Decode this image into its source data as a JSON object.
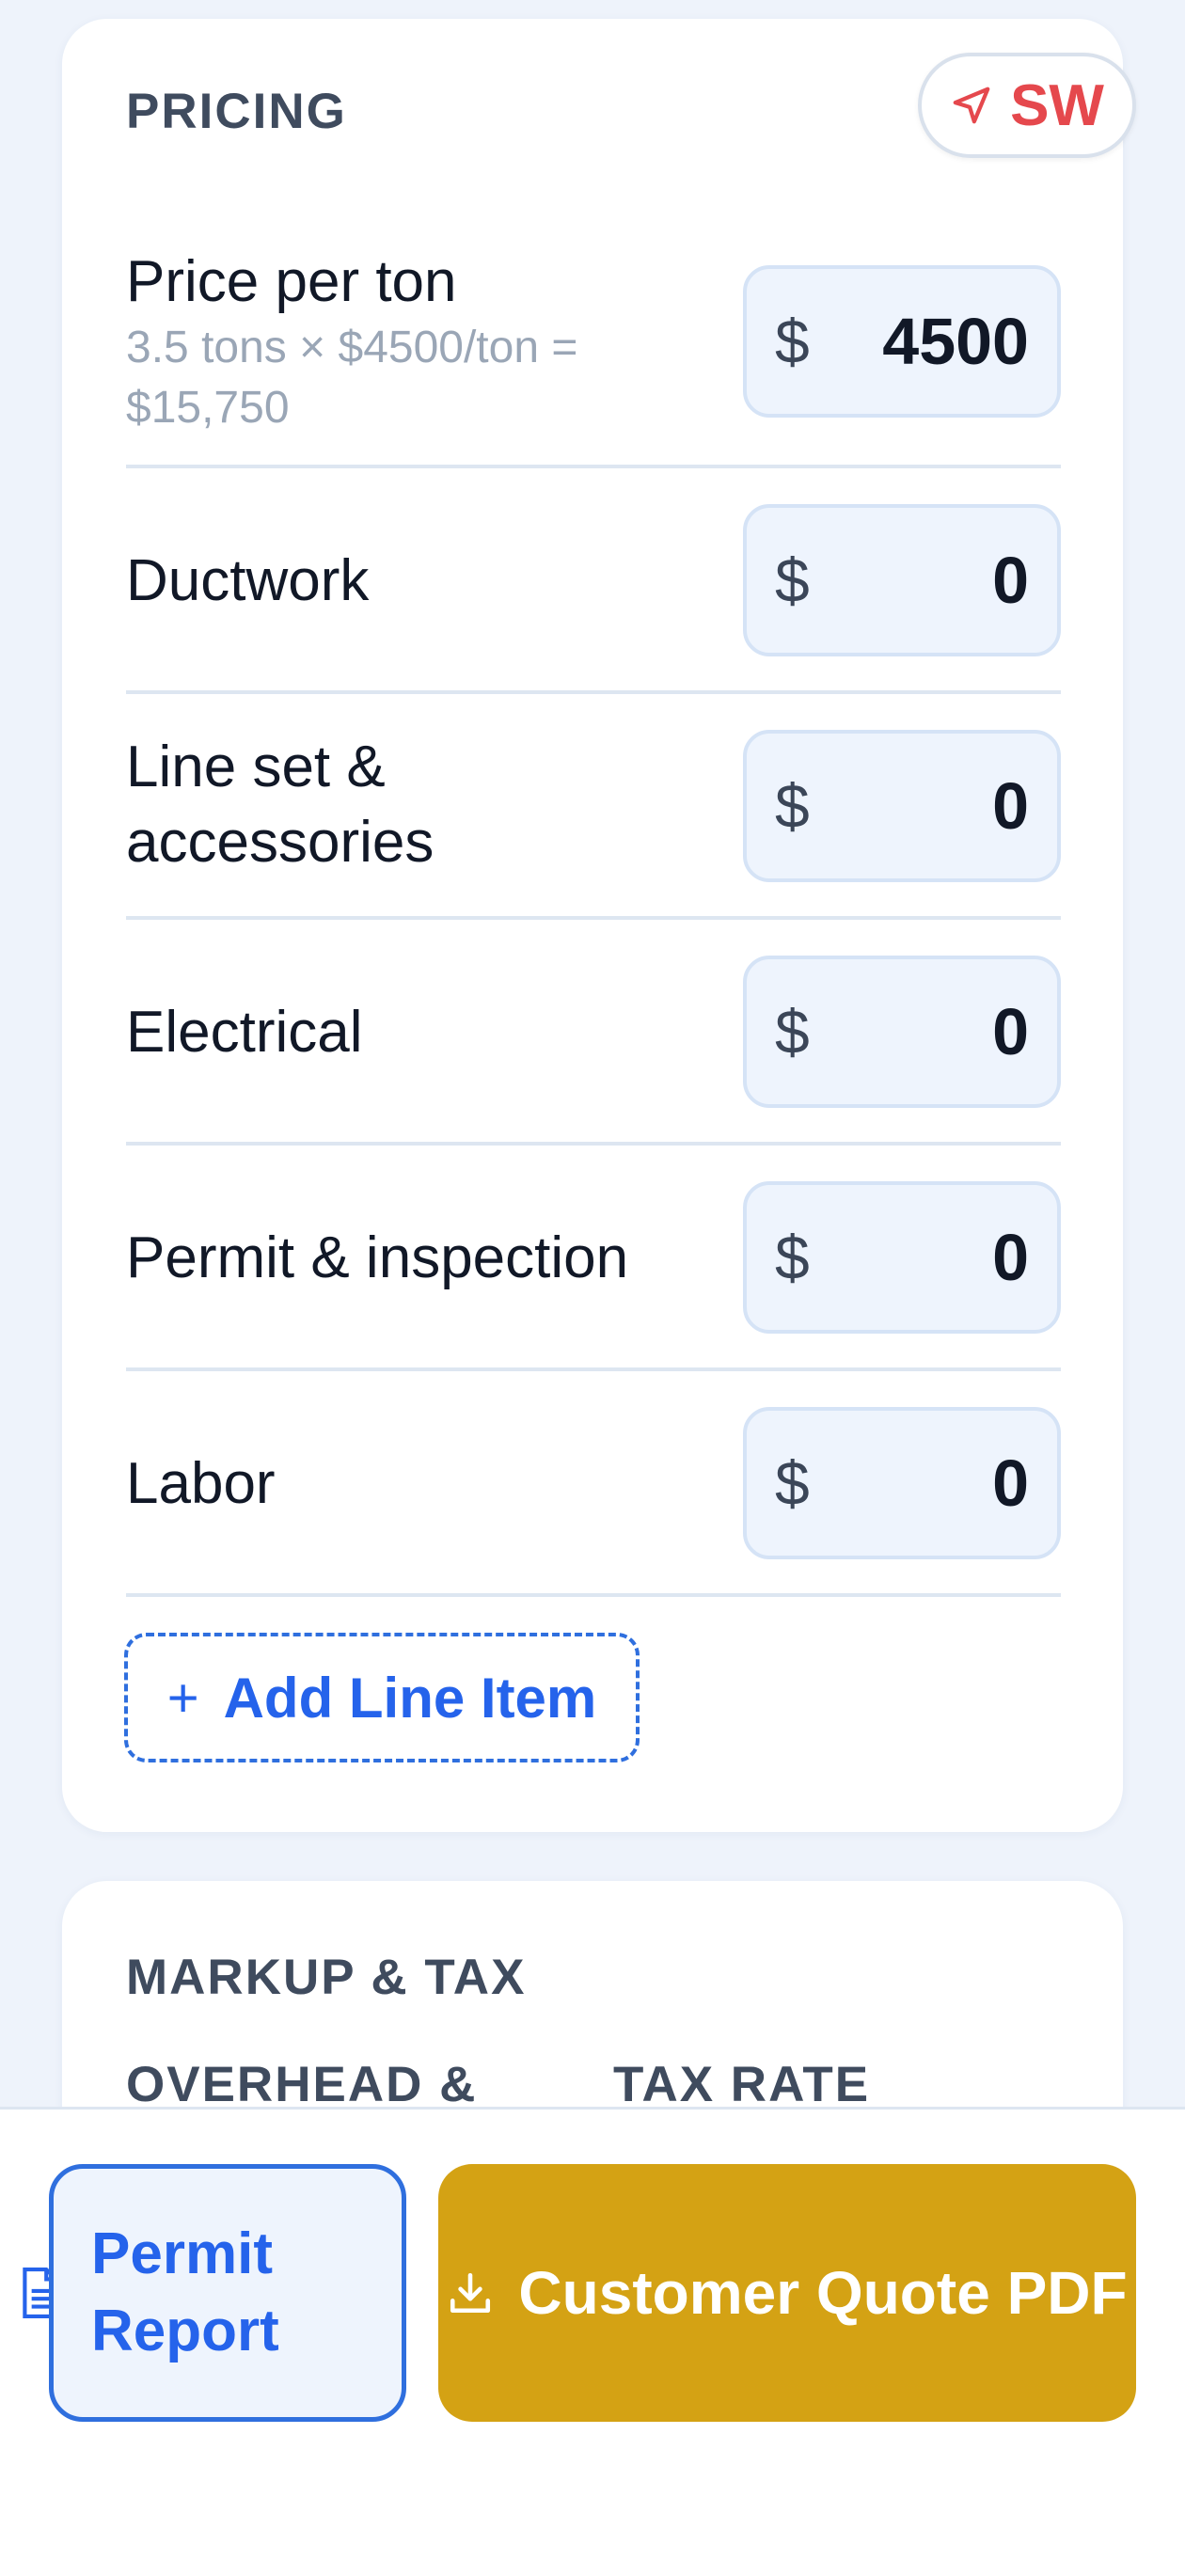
{
  "pricing": {
    "title": "PRICING",
    "region_code": "SW",
    "currency_symbol": "$",
    "price_per_ton": {
      "label": "Price per ton",
      "sub_line1": "3.5 tons × $4500/ton =",
      "sub_line2": "$15,750",
      "value": "4500"
    },
    "items": [
      {
        "label_line1": "Ductwork",
        "label_line2": "",
        "value": "0"
      },
      {
        "label_line1": "Line set &",
        "label_line2": "accessories",
        "value": "0"
      },
      {
        "label_line1": "Electrical",
        "label_line2": "",
        "value": "0"
      },
      {
        "label_line1": "Permit & inspection",
        "label_line2": "",
        "value": "0"
      },
      {
        "label_line1": "Labor",
        "label_line2": "",
        "value": "0"
      }
    ],
    "add_line_item_plus": "+",
    "add_line_item_label": "Add Line Item"
  },
  "markup": {
    "title": "MARKUP & TAX",
    "col_overhead": "OVERHEAD &",
    "col_tax_rate": "TAX RATE"
  },
  "actions": {
    "permit_line1": "Permit",
    "permit_line2": "Report",
    "quote_pdf": "Customer Quote PDF"
  },
  "colors": {
    "accent_blue": "#2563eb",
    "region_red": "#e5484d",
    "quote_gold": "#d4a214"
  },
  "icons": {
    "region": "navigation-arrow-icon",
    "permit": "document-icon",
    "quote": "download-icon"
  }
}
